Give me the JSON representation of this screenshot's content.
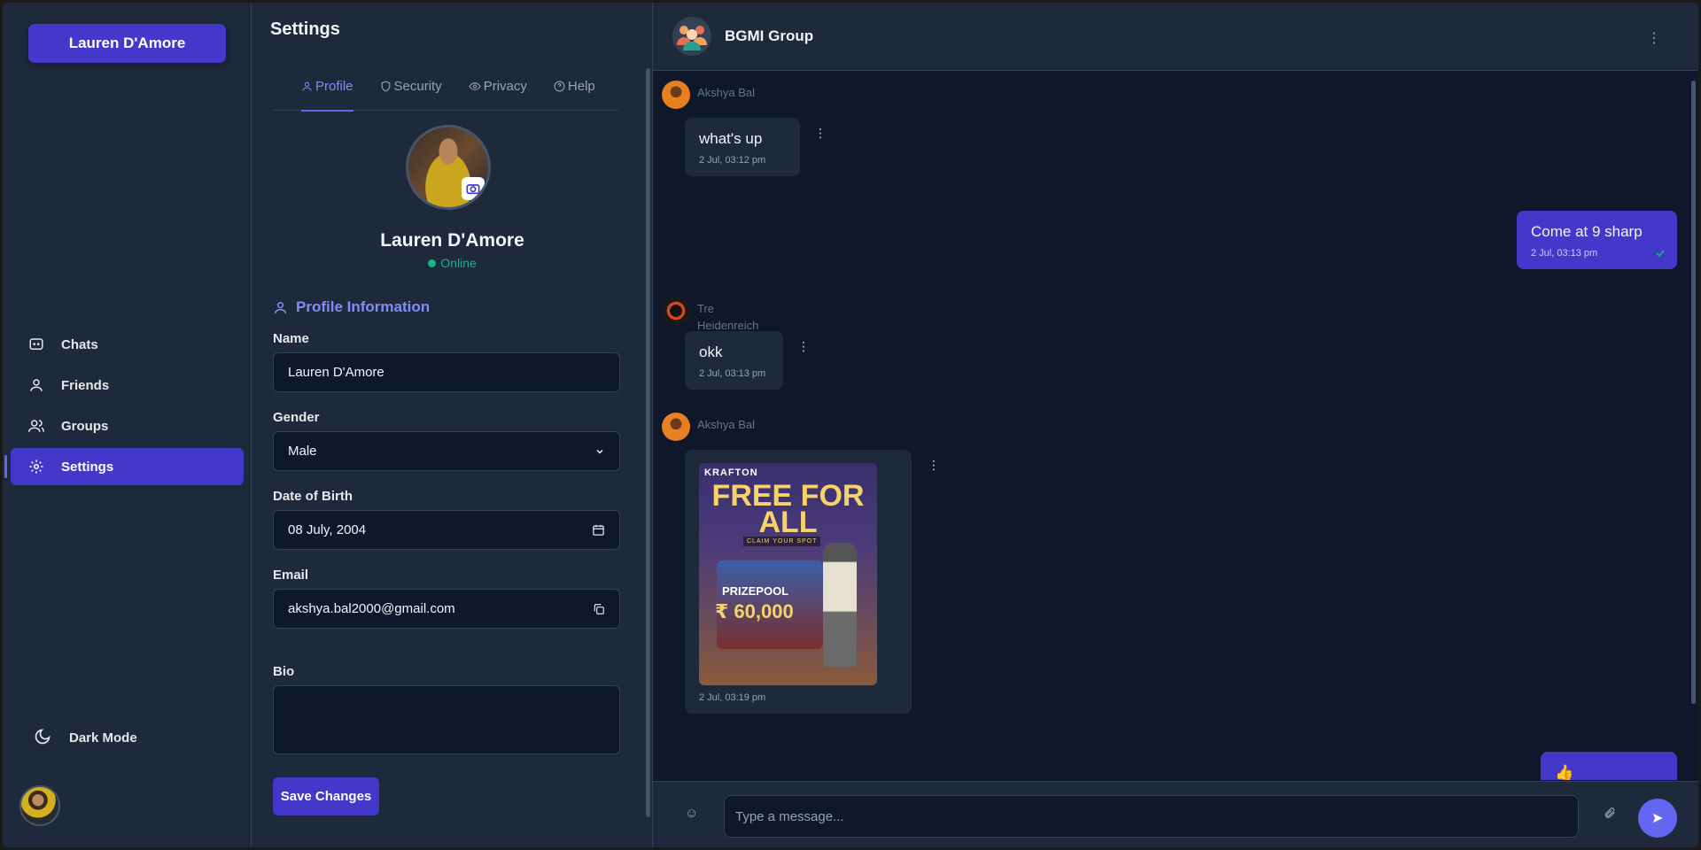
{
  "sidebar": {
    "user_button": "Lauren D'Amore",
    "items": [
      {
        "label": "Chats",
        "icon": "chat-icon"
      },
      {
        "label": "Friends",
        "icon": "user-icon"
      },
      {
        "label": "Groups",
        "icon": "users-icon"
      },
      {
        "label": "Settings",
        "icon": "gear-icon",
        "active": true
      }
    ],
    "dark_mode_label": "Dark Mode"
  },
  "settings": {
    "title": "Settings",
    "tabs": [
      {
        "label": "Profile",
        "icon": "user-icon",
        "active": true
      },
      {
        "label": "Security",
        "icon": "shield-icon"
      },
      {
        "label": "Privacy",
        "icon": "eye-icon"
      },
      {
        "label": "Help",
        "icon": "help-icon"
      }
    ],
    "profile_name": "Lauren D'Amore",
    "status": "Online",
    "section_title": "Profile Information",
    "fields": {
      "name": {
        "label": "Name",
        "value": "Lauren D'Amore"
      },
      "gender": {
        "label": "Gender",
        "value": "Male"
      },
      "dob": {
        "label": "Date of Birth",
        "value": "08 July, 2004"
      },
      "email": {
        "label": "Email",
        "value": "akshya.bal2000@gmail.com"
      },
      "bio": {
        "label": "Bio",
        "value": ""
      }
    },
    "save_label": "Save Changes"
  },
  "chat": {
    "group_name": "BGMI Group",
    "messages": [
      {
        "sender": "Akshya Bal",
        "text": "what's up",
        "time": "2 Jul, 03:12 pm"
      },
      {
        "mine": true,
        "text": "Come at 9 sharp",
        "time": "2 Jul, 03:13 pm"
      },
      {
        "sender_line1": "Tre",
        "sender_line2": "Heidenreich",
        "text": "okk",
        "time": "2 Jul, 03:13 pm"
      },
      {
        "sender": "Akshya Bal",
        "image": {
          "brand": "KRAFTON",
          "headline": "FREE FOR ALL",
          "claim": "CLAIM YOUR SPOT",
          "prize_label": "PRIZEPOOL",
          "prize_amount": "₹ 60,000"
        },
        "time": "2 Jul, 03:19 pm"
      },
      {
        "mine": true,
        "text": "👍"
      }
    ],
    "input_placeholder": "Type a message..."
  },
  "colors": {
    "accent": "#4338ca",
    "accent_light": "#818cf8",
    "online": "#10b981",
    "panel": "#1e293b",
    "chat_bg": "#0f172a"
  }
}
